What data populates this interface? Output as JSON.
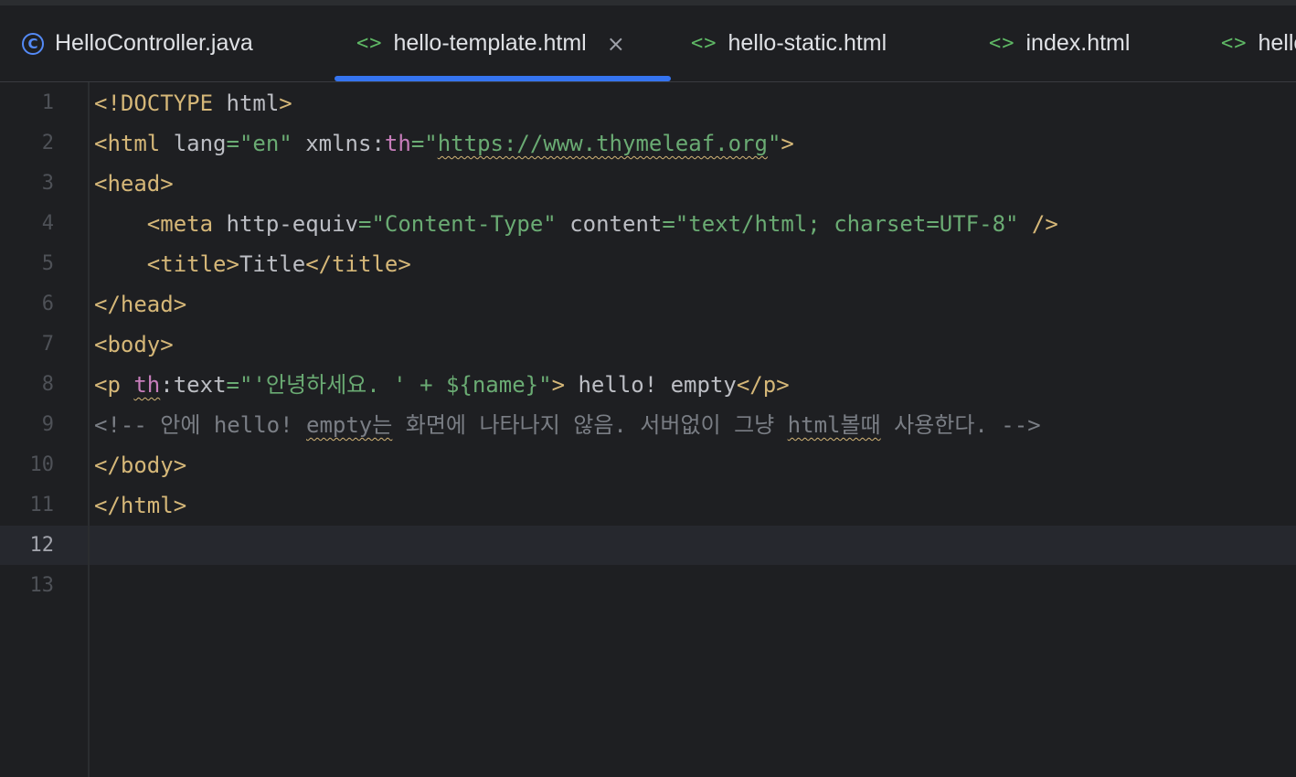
{
  "tabs": [
    {
      "label": "HelloController.java",
      "icon": "java-class-icon"
    },
    {
      "label": "hello-template.html",
      "icon": "html-file-icon",
      "active": true,
      "close": "×"
    },
    {
      "label": "hello-static.html",
      "icon": "html-file-icon"
    },
    {
      "label": "index.html",
      "icon": "html-file-icon"
    },
    {
      "label": "hello",
      "icon": "html-file-icon"
    }
  ],
  "editor": {
    "current_line": 12,
    "line_numbers": [
      "1",
      "2",
      "3",
      "4",
      "5",
      "6",
      "7",
      "8",
      "9",
      "10",
      "11",
      "12",
      "13"
    ],
    "tokens": {
      "l1_a": "<!DOCTYPE ",
      "l1_b": "html",
      "l1_c": ">",
      "l2_a": "<html ",
      "l2_b": "lang",
      "l2_c": "=",
      "l2_d": "\"en\"",
      "l2_e": " xmlns:",
      "l2_f": "th",
      "l2_g": "=",
      "l2_h": "\"",
      "l2_i": "https://www.thymeleaf.org",
      "l2_j": "\"",
      "l2_k": ">",
      "l3_a": "<head>",
      "l4_a": "    <meta ",
      "l4_b": "http-equiv",
      "l4_c": "=",
      "l4_d": "\"Content-Type\"",
      "l4_e": " content",
      "l4_f": "=",
      "l4_g": "\"text/html; charset=UTF-8\"",
      "l4_h": " />",
      "l5_a": "    <title>",
      "l5_b": "Title",
      "l5_c": "</title>",
      "l6_a": "</head>",
      "l7_a": "<body>",
      "l8_a": "<p ",
      "l8_b": "th",
      "l8_c": ":text",
      "l8_d": "=",
      "l8_e": "\"'안녕하세요. ' + ${name}\"",
      "l8_f": ">",
      "l8_g": " hello! empty",
      "l8_h": "</p>",
      "l9_a": "<!-- 안에 hello! ",
      "l9_b": "empty는",
      "l9_c": " 화면에 나타나지 않음. 서버없이 그냥 ",
      "l9_d": "html볼때",
      "l9_e": " 사용한다. -->",
      "l10_a": "</body>",
      "l11_a": "</html>"
    }
  }
}
